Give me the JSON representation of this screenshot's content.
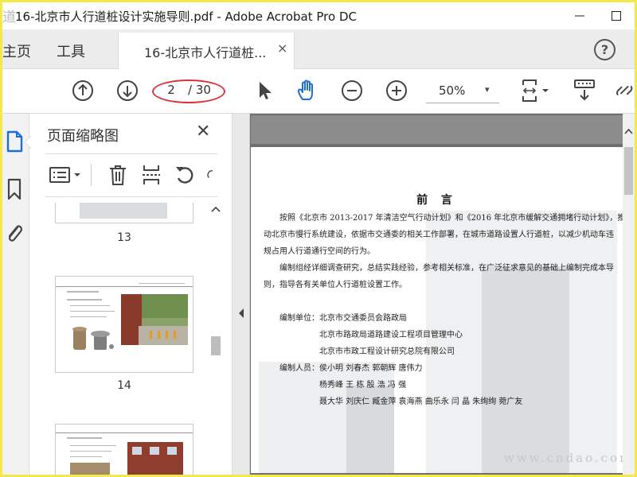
{
  "window": {
    "title": "16-北京市人行道桩设计实施导则.pdf - Adobe Acrobat Pro DC",
    "app_icon_text": "道桩"
  },
  "tabs": {
    "home": "主页",
    "tools": "工具",
    "document": "16-北京市人行道桩...",
    "close": "×",
    "help": "?"
  },
  "toolbar": {
    "current_page": "2",
    "page_total": "/ 30",
    "zoom": "50%",
    "zoom_caret": "▾",
    "annotation_color": "#d8343a"
  },
  "thumbnails_panel": {
    "title": "页面缩略图",
    "close": "✕",
    "items": [
      {
        "number": "13"
      },
      {
        "number": "14"
      }
    ]
  },
  "document_page": {
    "heading": "前  言",
    "paragraphs": [
      "按照《北京市 2013-2017 年清洁空气行动计划》和《2016 年北京市缓解交通拥堵行动计划》，推",
      "动北京市慢行系统建设，依据市交通委的相关工作部署，在城市道路设置人行道桩，以减少机动车违",
      "规占用人行道通行空间的行为。",
      "编制组经详细调查研究，总结实践经验，参考相关标准，在广泛征求意见的基础上编制完成本导",
      "则，指导各有关单位人行道桩设置工作。"
    ],
    "compilers_label": "编制单位：",
    "compilers": [
      "北京市交通委员会路政局",
      "北京市路政局道路建设工程项目管理中心",
      "北京市市政工程设计研究总院有限公司"
    ],
    "authors_label": "编制人员：",
    "authors": [
      "侯小明  刘春杰  郭朝辉   唐伟力",
      "杨秀峰  王  栋  殷  浩  冯  强",
      "聂大华  刘庆仁  臧金萍   袁海燕   曲乐永  闫  晶    朱绚绚    菀广友"
    ],
    "watermark": "www.cndao.com"
  },
  "colors": {
    "background_frame": "#f4e94a",
    "tabbar": "#ececec",
    "document_bg": "#6e6e6e"
  }
}
